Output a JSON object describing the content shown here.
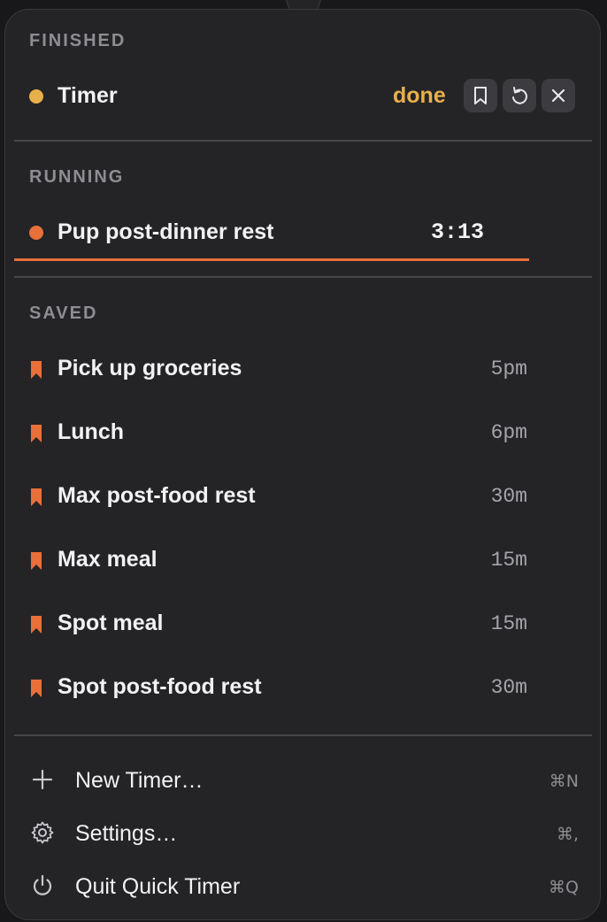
{
  "sections": {
    "finished": "FINISHED",
    "running": "RUNNING",
    "saved": "SAVED"
  },
  "finished_timer": {
    "label": "Timer",
    "status": "done",
    "dot_color": "#e8b04a",
    "actions": [
      "bookmark-icon",
      "restart-icon",
      "close-icon"
    ]
  },
  "running_timer": {
    "label": "Pup post-dinner rest",
    "time": "3:13",
    "dot_color": "#e8703a",
    "progress": 1.0
  },
  "saved_timers": [
    {
      "label": "Pick up groceries",
      "value": "5pm"
    },
    {
      "label": "Lunch",
      "value": "6pm"
    },
    {
      "label": "Max post-food rest",
      "value": "30m"
    },
    {
      "label": "Max meal",
      "value": "15m"
    },
    {
      "label": "Spot meal",
      "value": "15m"
    },
    {
      "label": "Spot post-food rest",
      "value": "30m"
    }
  ],
  "menu": {
    "new_timer": {
      "label": "New Timer…",
      "shortcut": "⌘N",
      "icon": "plus-icon"
    },
    "settings": {
      "label": "Settings…",
      "shortcut": "⌘,",
      "icon": "gear-icon"
    },
    "quit": {
      "label": "Quit Quick Timer",
      "shortcut": "⌘Q",
      "icon": "power-icon"
    }
  },
  "colors": {
    "accent": "#e8703a",
    "done": "#e8b04a",
    "panel_bg": "#242427"
  }
}
